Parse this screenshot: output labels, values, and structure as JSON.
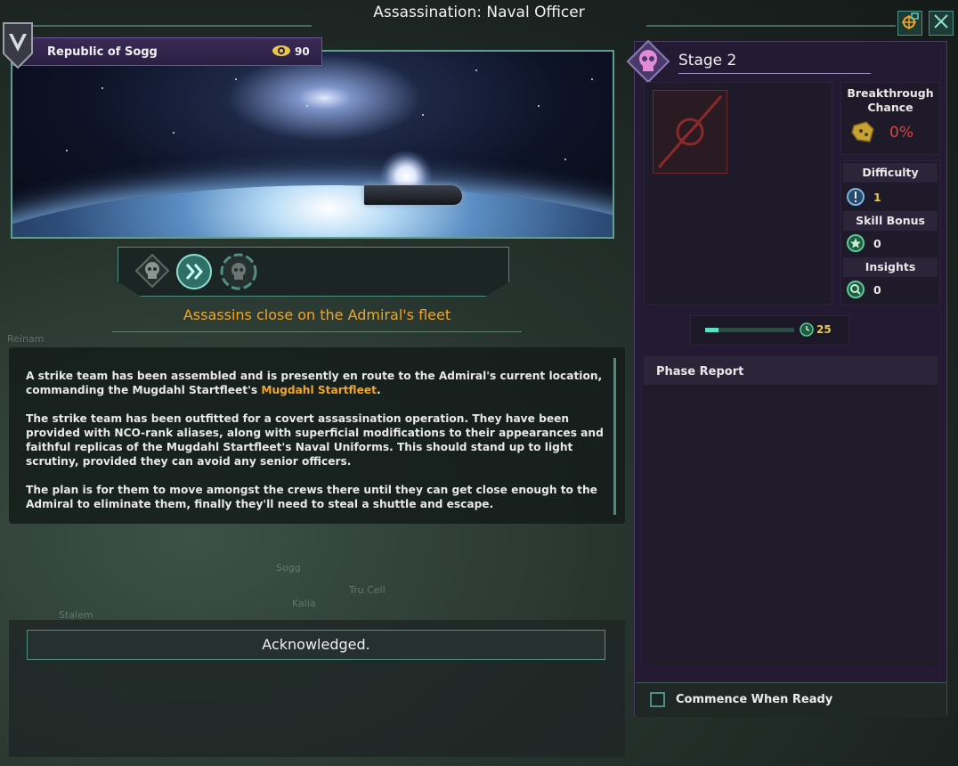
{
  "window": {
    "title": "Assassination: Naval Officer",
    "buttons": [
      "locate-icon",
      "close-icon"
    ]
  },
  "empire": {
    "name": "Republic of Sogg",
    "intel_value": "90"
  },
  "operation": {
    "stage_icons": [
      "skull-icon",
      "fast-forward-icon",
      "skull-icon"
    ],
    "current_stage_index": 1,
    "subtitle": "Assassins close on the Admiral's fleet",
    "description": {
      "p1_before": "A strike team has been assembled and is presently en route to the Admiral's current location, commanding the Mugdahl Startfleet's ",
      "p1_link": "Mugdahl Startfleet",
      "p1_after": ".",
      "p2": " The strike team has been outfitted for a covert assassination operation. They have been provided with NCO-rank aliases, along with superficial modifications to their appearances and faithful replicas of the Mugdahl Startfleet's Naval Uniforms. This should stand up to light scrutiny, provided they can avoid any senior officers.",
      "p3": "The plan is for them to move amongst the crews there until they can get close enough to the Admiral to eliminate them, finally they'll need to steal a shuttle and escape."
    },
    "acknowledge_label": "Acknowledged."
  },
  "map_labels": [
    "Reinam",
    "Sogg",
    "Tru Cell",
    "Kalia",
    "Stalem"
  ],
  "stage_panel": {
    "title": "Stage 2",
    "breakthrough": {
      "label": "Breakthrough Chance",
      "value": "0%",
      "color": "#e0443a"
    },
    "difficulty": {
      "label": "Difficulty",
      "value": "1",
      "color": "#e6c94a"
    },
    "skill_bonus": {
      "label": "Skill Bonus",
      "value": "0"
    },
    "insights": {
      "label": "Insights",
      "value": "0"
    },
    "progress": {
      "fraction": 0.15,
      "timer_value": "25",
      "timer_color": "#e6c94a"
    },
    "phase_report_label": "Phase Report",
    "commence_label": "Commence When Ready",
    "commence_checked": false
  },
  "colors": {
    "accent_teal": "#4f8f84",
    "highlight_orange": "#f0a52a",
    "panel_purple": "#241a33"
  }
}
